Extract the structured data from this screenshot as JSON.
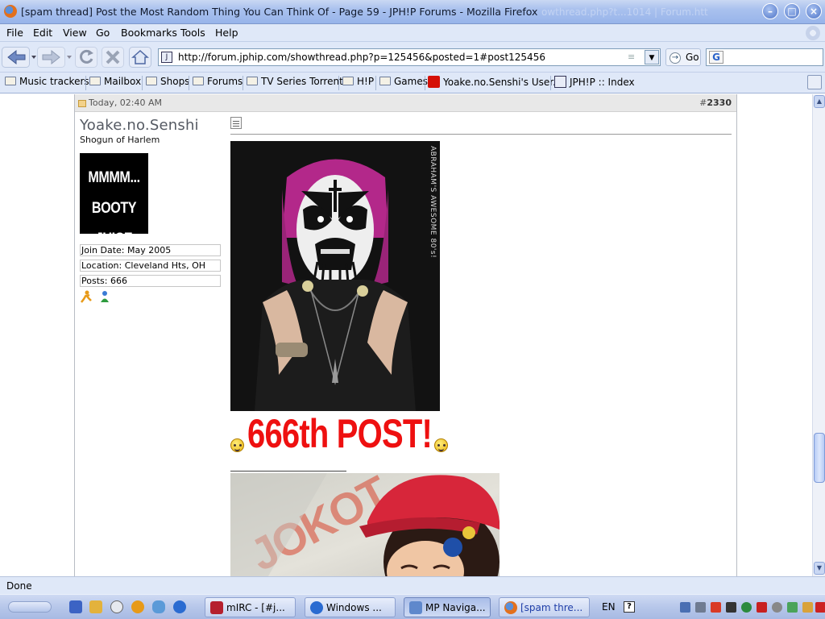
{
  "window": {
    "title": "[spam thread] Post the Most Random Thing You Can Think Of - Page 59 - JPH!P Forums - Mozilla Firefox",
    "ghost_title": "owthread.php?t...1014 | Forum.htt",
    "buttons": [
      "–",
      "□",
      "×"
    ]
  },
  "menu": [
    "File",
    "Edit",
    "View",
    "Go",
    "Bookmarks",
    "Tools",
    "Help"
  ],
  "nav": {
    "url": "http://forum.jphip.com/showthread.php?p=125456&posted=1#post125456",
    "go_label": "Go"
  },
  "bookmarks": [
    {
      "label": "Music trackers",
      "kind": "folder"
    },
    {
      "label": "Mailbox",
      "kind": "folder"
    },
    {
      "label": "Shops",
      "kind": "folder"
    },
    {
      "label": "Forums",
      "kind": "folder"
    },
    {
      "label": "TV Series Torrents",
      "kind": "folder"
    },
    {
      "label": "H!P",
      "kind": "folder"
    },
    {
      "label": "Games",
      "kind": "folder"
    },
    {
      "label": "Yoake.no.Senshi's User...",
      "kind": "lastfm"
    },
    {
      "label": "JPH!P :: Index",
      "kind": "site"
    }
  ],
  "post": {
    "date": "Today, 02:40 AM",
    "number_prefix": "#",
    "number": "2330",
    "user": {
      "name": "Yoake.no.Senshi",
      "title": "Shogun of Harlem",
      "avatar_line1": "MMMM...",
      "avatar_line2": "BOOTY JUICE",
      "join_date": "Join Date: May 2005",
      "location": "Location: Cleveland Hts, OH",
      "posts": "Posts: 666"
    },
    "image1_caption": "ABRAHAM'S AWESOME 80's!",
    "big_text": "666th POST!",
    "image2_text": "JOKOT"
  },
  "status": "Done",
  "taskbar": {
    "tasks": [
      "mIRC - [#j...",
      "Windows ...",
      "MP Naviga...",
      "[spam thre..."
    ],
    "lang": "EN",
    "help": "?"
  },
  "colors": {
    "big_text": "#ee1010",
    "titlebar": "#a9c1ee",
    "chrome": "#dfe8f8"
  }
}
